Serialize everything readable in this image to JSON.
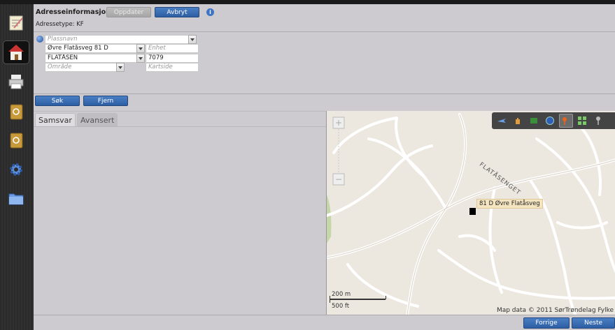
{
  "header": {
    "title": "Adresseinformasjon:",
    "update_label": "Oppdater",
    "cancel_label": "Avbryt",
    "address_type": "Adressetype: KF"
  },
  "form": {
    "place_placeholder": "Plassnavn",
    "street_value": "Øvre Flatåsveg 81 D",
    "unit_placeholder": "Enhet",
    "area_value": "FLATÅSEN",
    "postcode_value": "7079",
    "region_placeholder": "Område",
    "mapsheet_placeholder": "Kartside"
  },
  "actions": {
    "search_label": "Søk",
    "remove_label": "Fjern"
  },
  "tabs": [
    {
      "label": "Samsvar",
      "active": true
    },
    {
      "label": "Avansert",
      "active": false
    }
  ],
  "map": {
    "marker_label": "81 D Øvre Flatåsveg",
    "street_name": "FLATÅSENGET",
    "scale_metric": "200 m",
    "scale_imperial": "500 ft",
    "copyright": "Map data © 2011 SørTrøndelag Fylke"
  },
  "footer": {
    "prev_label": "Forrige",
    "next_label": "Neste"
  },
  "sidebar": {
    "items": [
      "notes-icon",
      "home-icon",
      "printer-icon",
      "address-book-icon",
      "address-book-icon-2",
      "gear-icon",
      "folder-icon"
    ],
    "active_index": 1
  },
  "colors": {
    "button_blue": "#2d5ea3",
    "map_bg": "#ece7df",
    "label_bg": "#f5e4c0"
  }
}
